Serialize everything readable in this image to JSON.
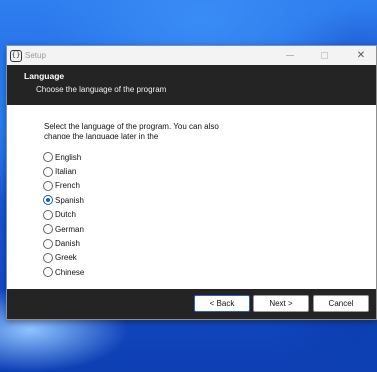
{
  "window": {
    "title": "Setup",
    "app_icon_glyph": "{}",
    "controls": {
      "close_glyph": "✕"
    }
  },
  "header": {
    "title": "Language",
    "subtitle": "Choose the language of the program"
  },
  "content": {
    "description": "Select the language of the program. You can also change the language later in the"
  },
  "languages": [
    {
      "label": "English",
      "selected": false
    },
    {
      "label": "Italian",
      "selected": false
    },
    {
      "label": "French",
      "selected": false
    },
    {
      "label": "Spanish",
      "selected": true
    },
    {
      "label": "Dutch",
      "selected": false
    },
    {
      "label": "German",
      "selected": false
    },
    {
      "label": "Danish",
      "selected": false
    },
    {
      "label": "Greek",
      "selected": false
    },
    {
      "label": "Chinese",
      "selected": false
    }
  ],
  "buttons": {
    "back": "< Back",
    "next": "Next >",
    "cancel": "Cancel"
  },
  "colors": {
    "accent": "#0f5fbf",
    "header_bg": "#242424",
    "desktop": "#1c5fd6"
  }
}
